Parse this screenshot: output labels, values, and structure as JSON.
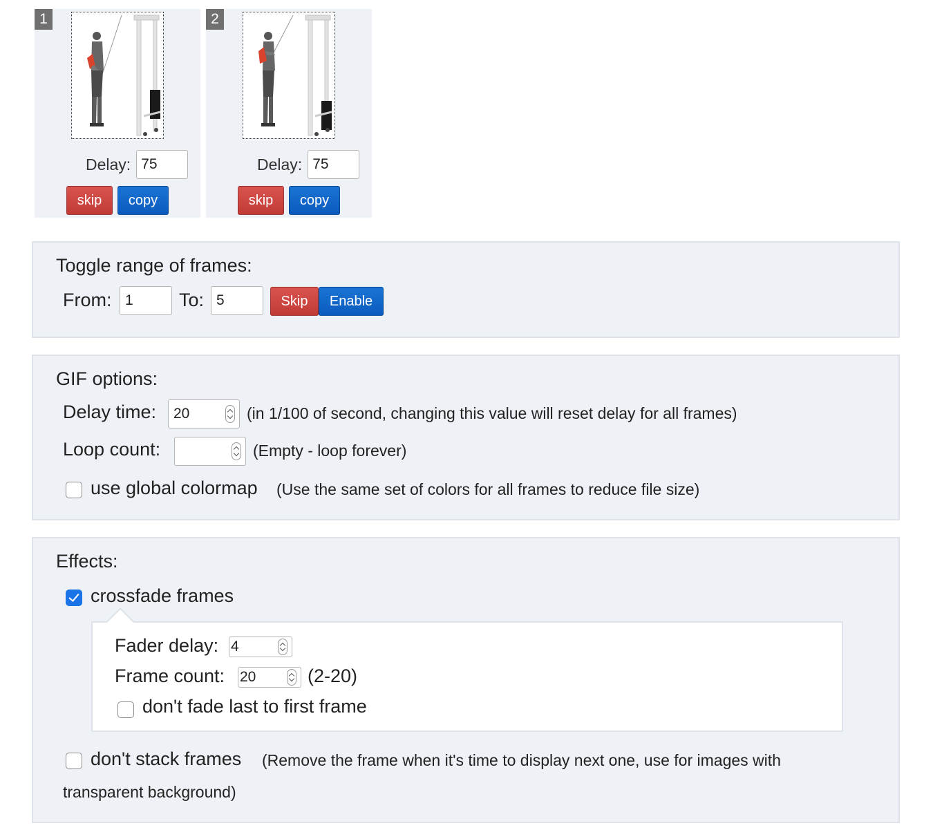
{
  "frames": [
    {
      "number": "1",
      "delay_label": "Delay:",
      "delay_value": "75",
      "skip_label": "skip",
      "copy_label": "copy"
    },
    {
      "number": "2",
      "delay_label": "Delay:",
      "delay_value": "75",
      "skip_label": "skip",
      "copy_label": "copy"
    }
  ],
  "toggle_range": {
    "title": "Toggle range of frames:",
    "from_label": "From:",
    "from_value": "1",
    "to_label": "To:",
    "to_value": "5",
    "skip_label": "Skip",
    "enable_label": "Enable"
  },
  "gif_options": {
    "title": "GIF options:",
    "delay_time_label": "Delay time:",
    "delay_time_value": "20",
    "delay_time_note": "(in 1/100 of second, changing this value will reset delay for all frames)",
    "loop_count_label": "Loop count:",
    "loop_count_value": "",
    "loop_count_note": "(Empty - loop forever)",
    "global_colormap_label": "use global colormap",
    "global_colormap_note": "(Use the same set of colors for all frames to reduce file size)",
    "global_colormap_checked": false
  },
  "effects": {
    "title": "Effects:",
    "crossfade_label": "crossfade frames",
    "crossfade_checked": true,
    "fader_delay_label": "Fader delay:",
    "fader_delay_value": "4",
    "frame_count_label": "Frame count:",
    "frame_count_value": "20",
    "frame_count_note": "(2-20)",
    "no_fade_last_label": "don't fade last to first frame",
    "no_fade_last_checked": false,
    "dont_stack_label": "don't stack frames",
    "dont_stack_note_1": "(Remove the frame when it's time to display next one, use for images with",
    "dont_stack_note_2": "transparent background)",
    "dont_stack_checked": false
  },
  "colors": {
    "skip_button": "#c9302c",
    "copy_button": "#0b5bbf",
    "panel_background": "#eef2f6",
    "checkbox_checked": "#1a74e8"
  },
  "icons": {
    "exercise_image": "cable-biceps-curl-figure",
    "spinner": "number-stepper-arrows"
  }
}
